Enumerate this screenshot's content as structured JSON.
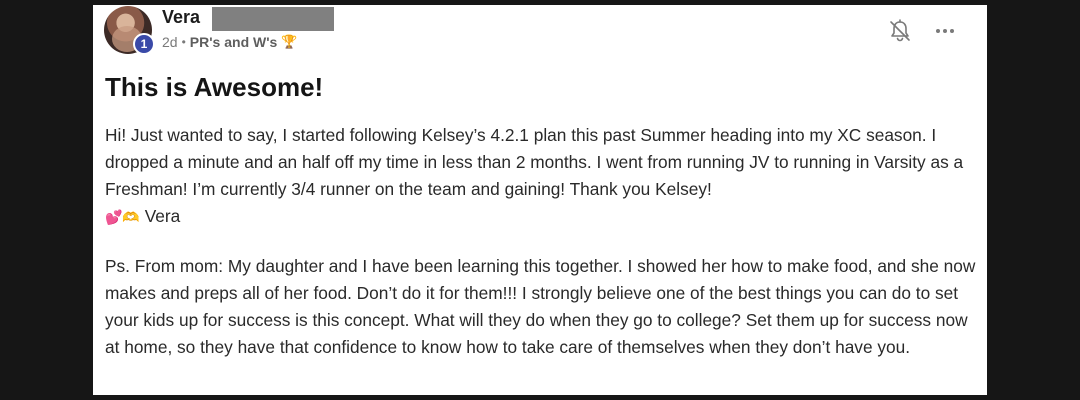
{
  "post": {
    "author": {
      "name": "Vera",
      "level": "1"
    },
    "meta": {
      "time": "2d",
      "separator": "•",
      "category": "PR's and W's",
      "category_icon": "trophy-icon"
    },
    "actions": {
      "notifications_icon": "bell-off-icon",
      "more_icon": "more-horizontal-icon"
    },
    "title": "This is Awesome!",
    "body": {
      "paragraph1": "Hi! Just wanted to say, I started following Kelsey’s 4.2.1 plan this past Summer heading into my XC season. I dropped a minute and an half off my time in less than 2 months. I went from running JV to running in Varsity as a Freshman! I’m currently 3/4 runner on the team and gaining! Thank you Kelsey!",
      "signature_emojis": "💕🫶",
      "signature": "Vera",
      "paragraph2": "Ps. From mom: My daughter and I have been learning this together. I showed her how to make food, and she now makes and preps all of her food. Don’t do it for them!!! I strongly believe one of the best things you can do to set your kids up for success is this concept. What will they do when they go to college? Set them up for success now at home, so they have that confidence to know how to take care of themselves when they don’t have you."
    }
  },
  "colors": {
    "background": "#161616",
    "card": "#ffffff",
    "badge": "#3a4aa8",
    "redaction": "#808080"
  }
}
